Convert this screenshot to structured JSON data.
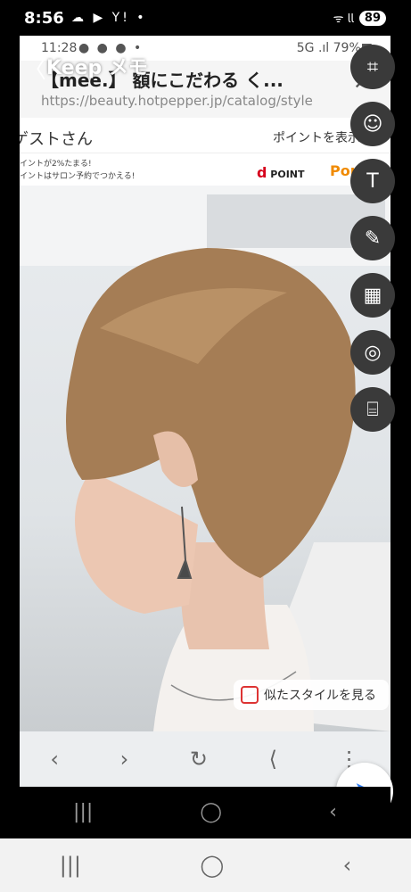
{
  "outer_status": {
    "time": "8:56",
    "notif_icons": "☁ ▶ Y! •",
    "signal": "ᯤ 𝗅𝗅",
    "battery": "89"
  },
  "inner_status": {
    "time": "11:28",
    "icons": "● ● ● •",
    "right": "5G .ıl 79%■"
  },
  "browser": {
    "title": "【mee.】 額にこだわる く...",
    "url": "https://beauty.hotpepper.jp/catalog/style",
    "close": "✕"
  },
  "banner": {
    "guest": "ゲストさん",
    "points": "ポイントを表示する",
    "line1": "イントが2%たまる!",
    "line2": "イントはサロン予約でつかえる!",
    "dpoint": "POINT",
    "dpoint_mark": "d",
    "ponta": "Ponta"
  },
  "similar_label": "似たスタイルを見る",
  "keep": {
    "back": "〈",
    "title": "Keep メモ"
  },
  "tools": {
    "crop": "⌗",
    "emoji": "☺",
    "text": "T",
    "pen": "✎",
    "mosaic": "▦",
    "blur": "◎",
    "ocr": "⌸"
  },
  "browser_nav": {
    "back": "‹",
    "forward": "›",
    "reload": "↻",
    "share": "⟨",
    "more": "⋮"
  },
  "send": "➤",
  "nav": {
    "recents": "|||",
    "home": "◯",
    "back": "‹"
  }
}
